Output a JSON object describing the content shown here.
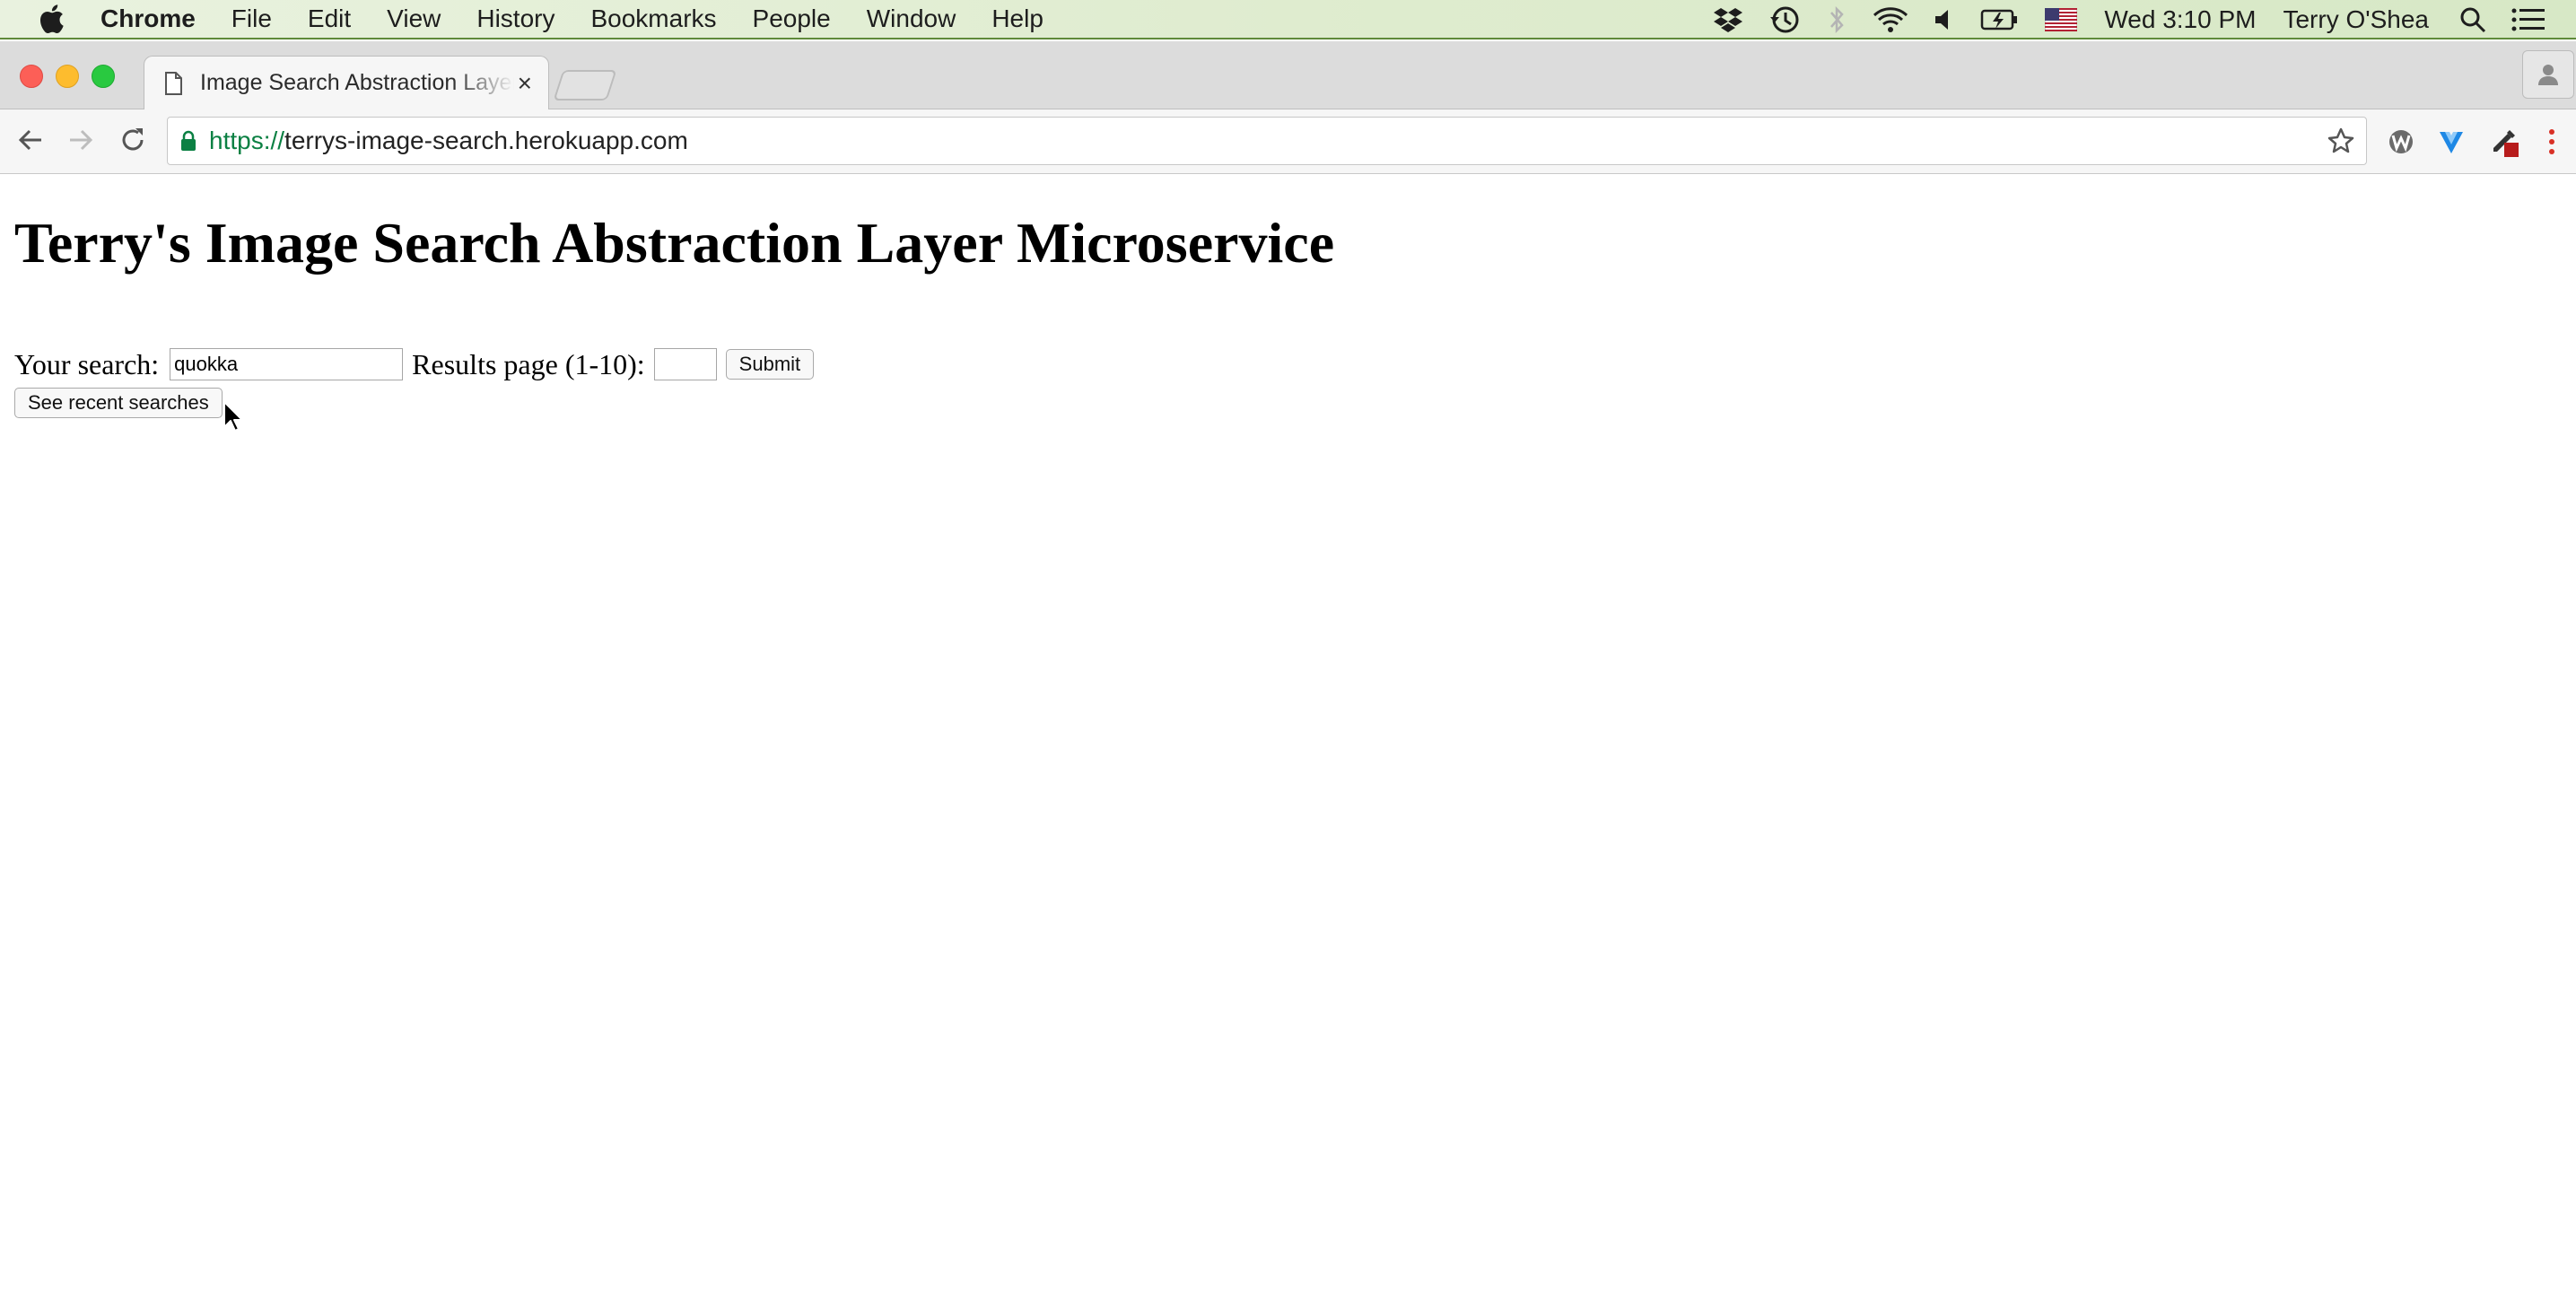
{
  "menubar": {
    "app_name": "Chrome",
    "items": [
      "File",
      "Edit",
      "View",
      "History",
      "Bookmarks",
      "People",
      "Window",
      "Help"
    ],
    "clock": "Wed 3:10 PM",
    "user": "Terry O'Shea"
  },
  "tab": {
    "title": "Image Search Abstraction Layer Microservice",
    "close_glyph": "×"
  },
  "address": {
    "scheme": "https://",
    "host": "terrys-image-search.herokuapp.com"
  },
  "page": {
    "heading": "Terry's Image Search Abstraction Layer Microservice",
    "search_label": "Your search:",
    "search_value": "quokka",
    "page_label": "Results page (1-10):",
    "page_value": "",
    "submit_label": "Submit",
    "recent_label": "See recent searches"
  },
  "colors": {
    "secure_green": "#0b8043",
    "close": "#fc5f57",
    "minimize": "#fdbc2e",
    "maximize": "#29c940"
  }
}
